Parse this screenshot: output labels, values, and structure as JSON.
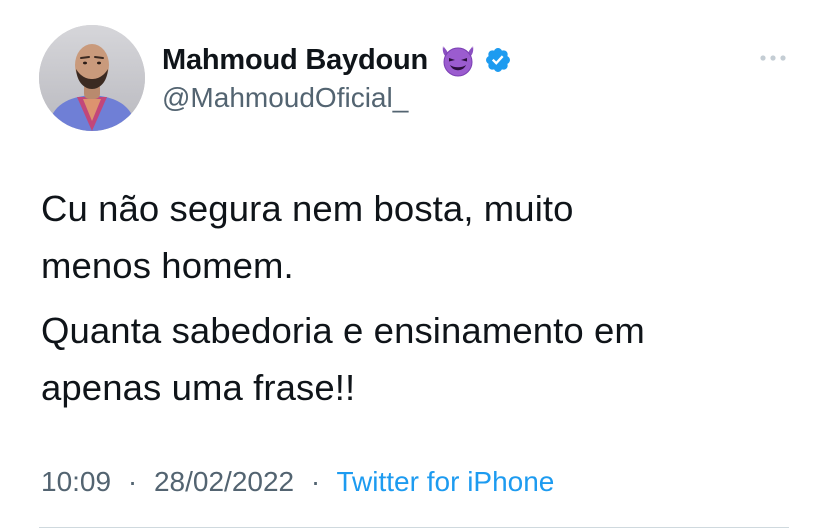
{
  "author": {
    "display_name": "Mahmoud Baydoun",
    "handle": "@MahmoudOficial_",
    "name_emoji": "smiling-imp-emoji",
    "verified": true
  },
  "tweet": {
    "paragraphs": [
      "Cu não segura nem bosta, muito\nmenos homem.",
      "Quanta sabedoria e ensinamento em\napenas uma frase!!"
    ]
  },
  "meta": {
    "time": "10:09",
    "date": "28/02/2022",
    "separator": "·",
    "source": "Twitter for iPhone"
  },
  "icons": {
    "more": "more-horizontal-icon",
    "verified": "verified-badge-icon"
  },
  "colors": {
    "text_primary": "#0f1419",
    "text_secondary": "#536471",
    "link": "#1d9bf0",
    "verified": "#1d9bf0",
    "emoji_purple": "#8a4fc1"
  }
}
